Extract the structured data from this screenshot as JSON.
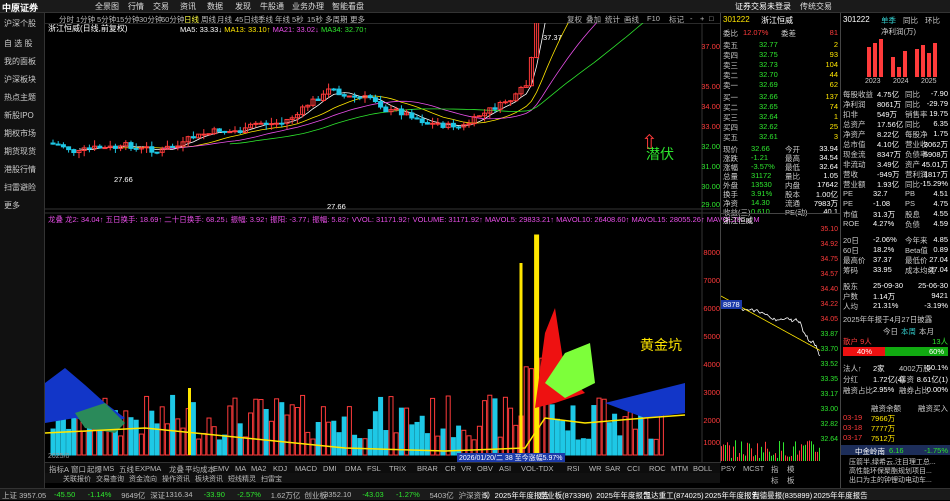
{
  "app": {
    "logo": "中原证券",
    "menu": [
      "全景图",
      "行情",
      "交易",
      "资讯",
      "数据",
      "发现",
      "牛股通",
      "业务办理",
      "智能看盘"
    ],
    "right_menu": [
      "证券交易未登录",
      "传统交易"
    ]
  },
  "left_nav": [
    "沪深个股",
    "自 选 股",
    "我的面板",
    "沪深板块",
    "热点主题",
    "新股IPO",
    "期权市场",
    "期货现货",
    "港股行情",
    "扫雷避险",
    "更多"
  ],
  "toolbar": {
    "periods": [
      "分时",
      "1分钟",
      "5分钟",
      "15分钟",
      "30分钟",
      "60分钟",
      "日线",
      "周线",
      "月线",
      "45日线",
      "季线",
      "年线",
      "5秒",
      "15秒",
      "多周期",
      "更多"
    ],
    "active": "日线",
    "right": [
      "复权",
      "叠加",
      "统计",
      "画线",
      "F10",
      "标记",
      "-",
      "+",
      "□"
    ]
  },
  "stock": {
    "title": "浙江恒威(日线,前复权)",
    "ma": [
      "MA5: 33.33↓",
      "MA13: 33.10↑",
      "MA21: 33.02↓",
      "MA34: 32.70↑"
    ],
    "ma_colors": [
      "#ffffff",
      "#ffe600",
      "#e94fe9",
      "#2ee62e"
    ],
    "high_label": "37.37",
    "low_label1": "27.66",
    "low_label2": "27.66",
    "annot_qianfu": "潜伏",
    "annot_huangjin": "黄金坑"
  },
  "price_axis": [
    "37.00",
    "35.00",
    "34.00",
    "33.00",
    "32.00",
    "31.00",
    "30.00",
    "29.00",
    "28.00"
  ],
  "sub": {
    "legend": "龙叠 龙2: 34.04↑ 五日换手: 18.69↑ 二十日换手: 68.25↓ 振幅: 3.92↑ 振阳: -3.77↓ 振幅: 5.82↑ VVOL: 31171.92↑ VOLUME: 31171.92↑ MAVOL5: 29833.21↑ MAVOL10: 26408.60↑ MAVOL15: 28055.26↑ MAVOL20: ... M",
    "date_tip": "2026/01/20/二 38 至今涨幅5.97%",
    "axis": [
      "8000",
      "7000",
      "6000",
      "5000",
      "4000",
      "3000",
      "2000",
      "1000"
    ],
    "left_date": "2025/0"
  },
  "indicator_tabs": [
    "指标A",
    "窗口",
    "起爆",
    "MS",
    "五线",
    "EXPMA",
    "龙叠",
    "平均成本",
    "EMV",
    "MA",
    "MA2",
    "KDJ",
    "MACD",
    "DMI",
    "DMA",
    "FSL",
    "TRIX",
    "BRAR",
    "CR",
    "VR",
    "OBV",
    "ASI",
    "VOL-TDX",
    "RSI",
    "WR",
    "SAR",
    "CCI",
    "ROC",
    "MTM",
    "BOLL",
    "PSY",
    "MCST",
    "指标",
    "模板"
  ],
  "bottom_tabs": [
    "关联报价",
    "交易查询",
    "资金流向",
    "操作资讯",
    "板块资讯",
    "短线精灵",
    "扫雷宝"
  ],
  "orderbook": {
    "code": "301222",
    "name": "浙江恒威",
    "ratio_label": "委比",
    "ratio": "12.07%",
    "diff_label": "委差",
    "diff": "81",
    "sells": [
      {
        "l": "卖五",
        "p": "32.77",
        "v": "2"
      },
      {
        "l": "卖四",
        "p": "32.75",
        "v": "93"
      },
      {
        "l": "卖三",
        "p": "32.73",
        "v": "104"
      },
      {
        "l": "卖二",
        "p": "32.70",
        "v": "44"
      },
      {
        "l": "卖一",
        "p": "32.69",
        "v": "62"
      }
    ],
    "buys": [
      {
        "l": "买一",
        "p": "32.66",
        "v": "137"
      },
      {
        "l": "买二",
        "p": "32.65",
        "v": "74"
      },
      {
        "l": "买三",
        "p": "32.64",
        "v": "1"
      },
      {
        "l": "买四",
        "p": "32.62",
        "v": "25"
      },
      {
        "l": "买五",
        "p": "32.61",
        "v": "3"
      }
    ],
    "stats": [
      [
        "现价",
        "32.66",
        "今开",
        "33.94"
      ],
      [
        "涨跌",
        "-1.21",
        "最高",
        "34.54"
      ],
      [
        "涨幅",
        "-3.57%",
        "最低",
        "32.64"
      ],
      [
        "总量",
        "31172",
        "量比",
        "1.05"
      ],
      [
        "外盘",
        "13530",
        "内盘",
        "17642"
      ],
      [
        "换手",
        "3.91%",
        "股本",
        "1.00亿"
      ],
      [
        "净资",
        "14.30",
        "流通",
        "7983万"
      ],
      [
        "收益(三)",
        "0.610",
        "PE(动)",
        "40.1"
      ]
    ]
  },
  "tline": {
    "name": "浙江恒威",
    "axis": [
      "35.10",
      "34.92",
      "34.75",
      "34.57",
      "34.40",
      "34.22",
      "34.05",
      "33.87",
      "33.70",
      "33.52",
      "33.35",
      "33.17",
      "33.00",
      "32.82",
      "32.64"
    ],
    "marker": "8878"
  },
  "rp": {
    "code": "301222",
    "tabs": [
      "单季",
      "同比",
      "环比"
    ],
    "metric": "净利润(万)",
    "years": [
      "2023",
      "2024",
      "2025"
    ],
    "fin": [
      [
        "每股收益",
        "4.75亿",
        "同比",
        "-7.90"
      ],
      [
        "净利润",
        "8061万",
        "同比",
        "-29.79"
      ],
      [
        "扣非",
        "549万",
        "销售率",
        "19.75"
      ],
      [
        "总资产",
        "17.56亿",
        "同比",
        "6.35"
      ],
      [
        "净资产",
        "8.22亿",
        "每股净",
        "1.75"
      ],
      [
        "总市值",
        "4.10亿",
        "营业收",
        "3062万"
      ],
      [
        "现金流",
        "8347万",
        "负债率",
        "5908万"
      ],
      [
        "非流动",
        "3.49亿",
        "资产",
        "45.01万"
      ],
      [
        "营收",
        "-949万",
        "营利润",
        "1817万"
      ],
      [
        "营业额",
        "1.93亿",
        "同比",
        "-15.29%"
      ]
    ],
    "val": [
      [
        "PE",
        "32.7",
        "PB",
        "4.51"
      ],
      [
        "PE",
        "-1.08",
        "PS",
        "4.75"
      ],
      [
        "市值",
        "31.3万",
        "股息",
        "4.55"
      ],
      [
        "ROE",
        "4.27%",
        "负债",
        "4.59"
      ]
    ],
    "perf": [
      [
        "20日",
        "-2.06%",
        "今年来",
        "4.85"
      ],
      [
        "60日",
        "18.2%",
        "Beta值",
        "0.89"
      ],
      [
        "最高价",
        "37.37",
        "最低价",
        "27.04"
      ],
      [
        "筹码",
        "33.95",
        "成本均线",
        "27.04"
      ]
    ],
    "share": [
      [
        "股东",
        "25-09-30",
        "",
        "25-06-30"
      ],
      [
        "户数",
        "1.14万",
        "",
        "9421"
      ],
      [
        "人均",
        "21.31%",
        "",
        "-3.19%"
      ]
    ],
    "report": "2025年年报于4月27日披露",
    "flow_tabs": [
      "今日",
      "本周",
      "本月"
    ],
    "flow_label": "散户 9人",
    "flow_right": "13人",
    "bar_left": "40%",
    "bar_right": "60%",
    "inst": [
      [
        "法人↑",
        "2家",
        "4002万股",
        "50.1%"
      ],
      [
        "分红",
        "1.72亿(4)",
        "募资",
        "8.61亿(1)"
      ],
      [
        "融资占比",
        "2.95%",
        "融券占比",
        "0.00%"
      ]
    ],
    "margin_head": [
      "",
      "融资余额",
      "",
      "融资买入"
    ],
    "margin": [
      [
        "03-19",
        "7966万",
        "",
        ""
      ],
      [
        "03-18",
        "7777万",
        "",
        ""
      ],
      [
        "03-17",
        "7512万",
        "",
        ""
      ]
    ],
    "news_title": "中金岭南",
    "news_val": "6.16",
    "news_pct": "-1.75%",
    "news": [
      "压箭半,绿希云,注目理工总...",
      "高性能环保聚酯规划项目...",
      "出口为主的钟锂动电动车..."
    ]
  },
  "status": {
    "items": [
      "上证 3957.05",
      "-45.50",
      "-1.14%",
      "9649亿",
      "深证",
      "1316.34",
      "-33.90",
      "-2.57%",
      "1.62万亿",
      "创业板",
      "3352.10",
      "-43.03",
      "-1.27%",
      "5403亿",
      "沪深资讯",
      "5）2025年年度报告",
      "创业板(873396)",
      "2025年年度报告",
      "凯达重工(874025)",
      "2025年年度报告",
      "利德曼报(835899)",
      "2025年年度报告"
    ]
  }
}
